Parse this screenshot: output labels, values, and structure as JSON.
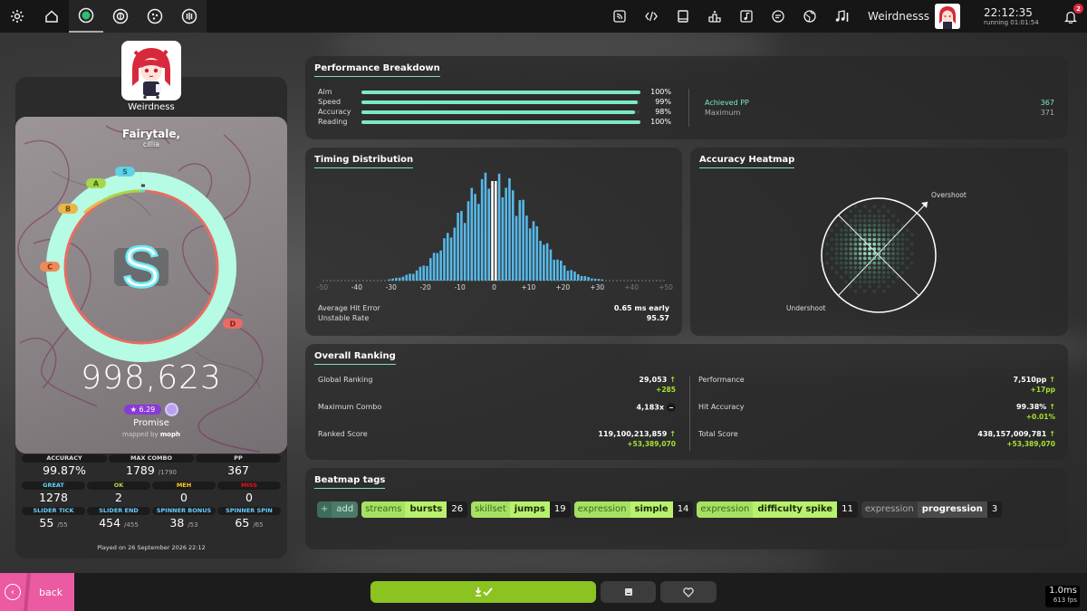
{
  "topbar": {
    "username": "Weirdnesss",
    "time": "22:12:35",
    "running": "running 01:01:54",
    "notifications": "2"
  },
  "player": {
    "username": "Weirdness",
    "song_title": "Fairytale,",
    "song_artist": "cillia",
    "rank": "S",
    "score": "998,623",
    "star_rating": "★ 6.29",
    "difficulty": "Promise",
    "mapped_by_prefix": "mapped by",
    "mapper": "moph",
    "grade_labels": [
      "S",
      "A",
      "B",
      "C",
      "D"
    ],
    "accuracy_fraction": 0.9987,
    "stats_top": [
      {
        "label": "ACCURACY",
        "value": "99.87%",
        "sub": "",
        "color": "#dddddd"
      },
      {
        "label": "MAX COMBO",
        "value": "1789",
        "sub": "/1790",
        "color": "#dddddd"
      },
      {
        "label": "PP",
        "value": "367",
        "sub": "",
        "color": "#dddddd"
      }
    ],
    "stats_hits": [
      {
        "label": "GREAT",
        "value": "1278",
        "color": "#66ccff"
      },
      {
        "label": "OK",
        "value": "2",
        "color": "#b3d944"
      },
      {
        "label": "MEH",
        "value": "0",
        "color": "#ffcc22"
      },
      {
        "label": "MISS",
        "value": "0",
        "color": "#ed1121"
      }
    ],
    "stats_ticks": [
      {
        "label": "SLIDER TICK",
        "value": "55",
        "sub": "/55",
        "color": "#66ccff"
      },
      {
        "label": "SLIDER END",
        "value": "454",
        "sub": "/455",
        "color": "#66ccff"
      },
      {
        "label": "SPINNER BONUS",
        "value": "38",
        "sub": "/53",
        "color": "#66ccff"
      },
      {
        "label": "SPINNER SPIN",
        "value": "65",
        "sub": "/65",
        "color": "#66ccff"
      }
    ],
    "played_on": "Played on 26 September 2026 22:12"
  },
  "performance": {
    "title": "Performance Breakdown",
    "rows": [
      {
        "label": "Aim",
        "value": 1.0,
        "text": "100%"
      },
      {
        "label": "Speed",
        "value": 0.99,
        "text": "99%"
      },
      {
        "label": "Accuracy",
        "value": 0.98,
        "text": "98%"
      },
      {
        "label": "Reading",
        "value": 1.0,
        "text": "100%"
      }
    ],
    "achieved_label": "Achieved PP",
    "achieved_value": "367",
    "maximum_label": "Maximum",
    "maximum_value": "371"
  },
  "timing": {
    "title": "Timing Distribution",
    "ticks": [
      "-50",
      "-40",
      "-30",
      "-20",
      "-10",
      "0",
      "+10",
      "+20",
      "+30",
      "+40",
      "+50"
    ],
    "avg_label": "Average Hit Error",
    "avg_value": "0.65 ms early",
    "ur_label": "Unstable Rate",
    "ur_value": "95.57"
  },
  "heatmap": {
    "title": "Accuracy Heatmap",
    "overshoot": "Overshoot",
    "undershoot": "Undershoot"
  },
  "ranking": {
    "title": "Overall Ranking",
    "left": [
      {
        "label": "Global Ranking",
        "value": "29,053",
        "delta": "+285",
        "icon": "up"
      },
      {
        "label": "Maximum Combo",
        "value": "4,183x",
        "delta": "",
        "icon": "none"
      },
      {
        "label": "Ranked Score",
        "value": "119,100,213,859",
        "delta": "+53,389,070",
        "icon": "up"
      }
    ],
    "right": [
      {
        "label": "Performance",
        "value": "7,510pp",
        "delta": "+17pp",
        "icon": "up"
      },
      {
        "label": "Hit Accuracy",
        "value": "99.38%",
        "delta": "+0.01%",
        "icon": "up"
      },
      {
        "label": "Total Score",
        "value": "438,157,009,781",
        "delta": "+53,389,070",
        "icon": "up"
      }
    ]
  },
  "tags": {
    "title": "Beatmap tags",
    "add": {
      "plus": "+",
      "label": "add"
    },
    "items": [
      {
        "cat": "streams",
        "name": "bursts",
        "count": "26",
        "style": "green"
      },
      {
        "cat": "skillset",
        "name": "jumps",
        "count": "19",
        "style": "green"
      },
      {
        "cat": "expression",
        "name": "simple",
        "count": "14",
        "style": "green"
      },
      {
        "cat": "expression",
        "name": "difficulty spike",
        "count": "11",
        "style": "green"
      },
      {
        "cat": "expression",
        "name": "progression",
        "count": "3",
        "style": "grey"
      }
    ]
  },
  "bottom": {
    "back": "back",
    "fps_ms": "1.0ms",
    "fps": "613 fps"
  }
}
